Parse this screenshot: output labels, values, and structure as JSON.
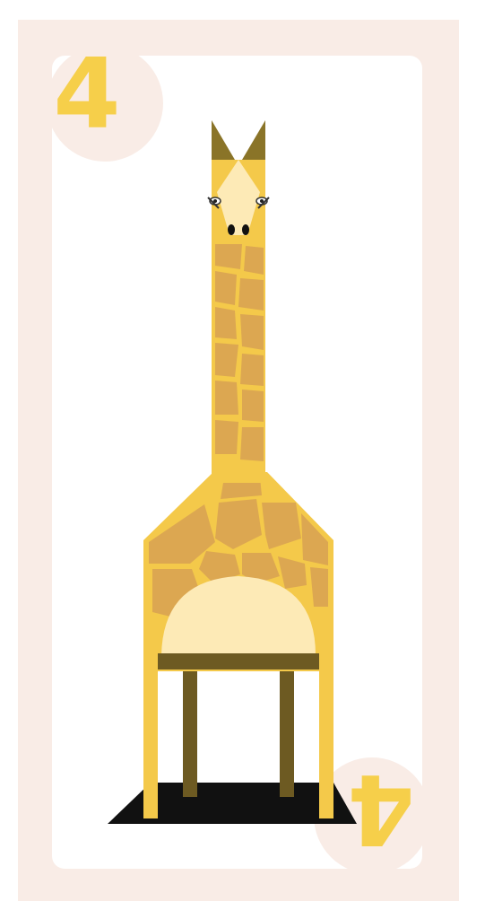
{
  "card": {
    "rank_top": "4",
    "rank_bottom": "4"
  },
  "colors": {
    "card_border": "#f9ece6",
    "card_face": "#ffffff",
    "rank": "#f6cf4a",
    "giraffe_body": "#f4c94a",
    "giraffe_patch": "#dca751",
    "giraffe_belly": "#fdeab6",
    "ossicone": "#8a7428",
    "legs": "#6d5a22",
    "shadow": "#111111"
  },
  "illustration": {
    "subject": "giraffe",
    "icon": "giraffe-illustration"
  }
}
